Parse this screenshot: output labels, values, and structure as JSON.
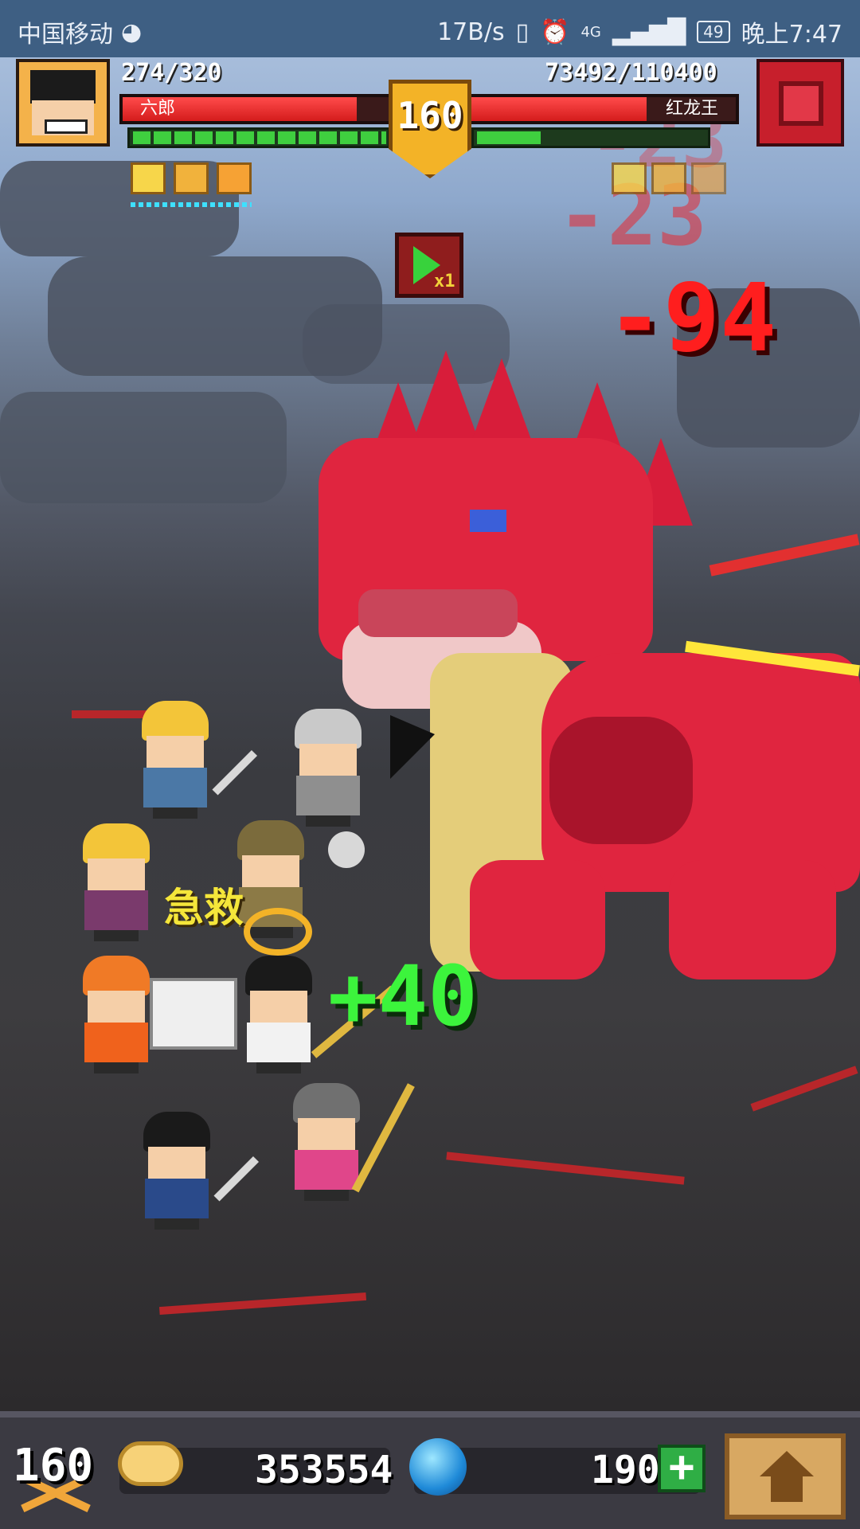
{
  "status_bar": {
    "carrier": "中国移动",
    "network_speed": "17B/s",
    "network_type": "4G",
    "battery": "49",
    "time": "晚上7:47"
  },
  "player": {
    "hp_text": "274/320",
    "name": "六郎",
    "level": "160"
  },
  "boss": {
    "hp_text": "73492/110400",
    "name": "红龙王"
  },
  "battle": {
    "speed_label": "x1",
    "damage_main": "-94",
    "damage_faded": "-23",
    "heal_text": "+40",
    "rescue_text": "急救"
  },
  "footer": {
    "level_badge": "160",
    "gold": "353554",
    "gems": "190",
    "add_label": "+"
  },
  "colors": {
    "hp_red": "#e22424",
    "sp_green": "#3fcf3f",
    "dragon_red": "#e0253f",
    "heal_green": "#3cf43c",
    "damage_red": "#ff1e1e"
  }
}
